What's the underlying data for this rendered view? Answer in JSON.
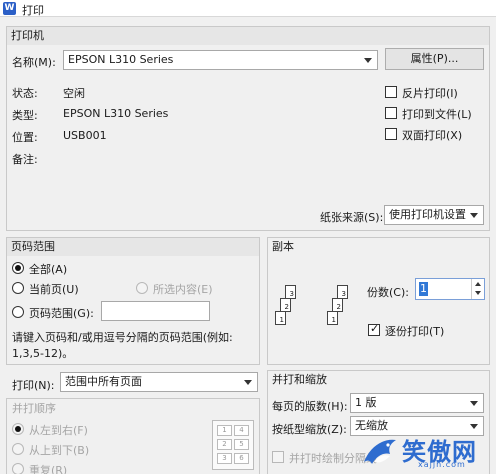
{
  "window": {
    "icon_letter": "W",
    "title": "打印"
  },
  "printer": {
    "section_title": "打印机",
    "name_label": "名称(M):",
    "name_value": "EPSON L310 Series",
    "properties_button": "属性(P)...",
    "status_label": "状态:",
    "status_value": "空闲",
    "type_label": "类型:",
    "type_value": "EPSON L310 Series",
    "location_label": "位置:",
    "location_value": "USB001",
    "comment_label": "备注:",
    "reverse_print": "反片打印(I)",
    "print_to_file": "打印到文件(L)",
    "duplex_print": "双面打印(X)",
    "paper_source_label": "纸张来源(S):",
    "paper_source_value": "使用打印机设置"
  },
  "page_range": {
    "section_title": "页码范围",
    "all": "全部(A)",
    "current_page": "当前页(U)",
    "selection": "所选内容(E)",
    "pages": "页码范围(G):",
    "hint_line1": "请键入页码和/或用逗号分隔的页码范围(例如:",
    "hint_line2": "1,3,5-12)。"
  },
  "copies": {
    "section_title": "副本",
    "count_label": "份数(C):",
    "count_value": "1",
    "collate": "逐份打印(T)",
    "page_numbers": [
      "3",
      "2",
      "1",
      "3",
      "2",
      "1"
    ]
  },
  "print_what": {
    "label": "打印(N):",
    "value": "范围中所有页面"
  },
  "merge_order": {
    "section_title": "并打顺序",
    "left_to_right": "从左到右(F)",
    "top_to_bottom": "从上到下(B)",
    "repeat": "重复(R)",
    "thumb_numbers": [
      "1",
      "4",
      "2",
      "5",
      "3",
      "6"
    ]
  },
  "zoom": {
    "section_title": "并打和缩放",
    "pages_per_sheet_label": "每页的版数(H):",
    "pages_per_sheet_value": "1 版",
    "scale_label": "按纸型缩放(Z):",
    "scale_value": "无缩放",
    "draw_borders": "并打时绘制分隔线"
  },
  "watermark": {
    "brand": "笑傲网",
    "url": "xajjn.com"
  },
  "colors": {
    "accent": "#3178d6",
    "logo": "#2e6ccf"
  }
}
